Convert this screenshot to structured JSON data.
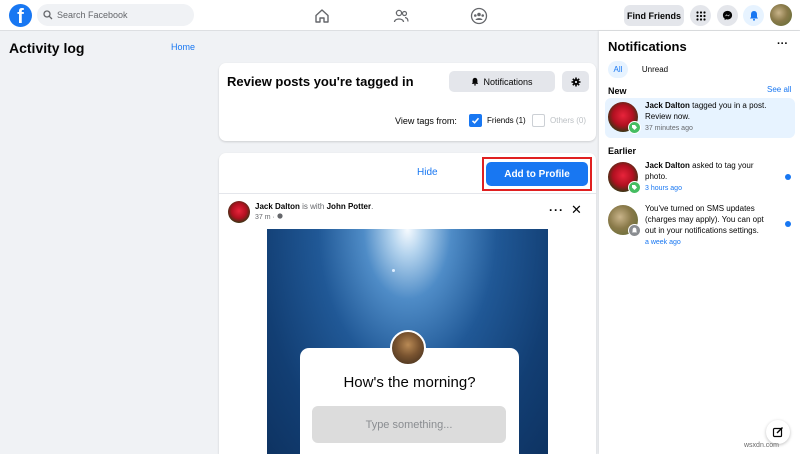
{
  "topnav": {
    "logo": "f",
    "search_placeholder": "Search Facebook",
    "find_friends": "Find Friends"
  },
  "left": {
    "title": "Activity log",
    "home_link": "Home"
  },
  "review": {
    "title": "Review posts you're tagged in",
    "notifications_button": "Notifications",
    "view_tags_label": "View tags from:",
    "friends_option": "Friends (1)",
    "friends_checked": true,
    "others_option": "Others (0)",
    "others_checked": false
  },
  "post": {
    "hide_label": "Hide",
    "add_to_profile_label": "Add to Profile",
    "author": "Jack Dalton",
    "with_text": "is with",
    "tagged": "John Potter",
    "time": "37 m",
    "prompt_question": "How's the morning?",
    "prompt_placeholder": "Type something..."
  },
  "notifications": {
    "title": "Notifications",
    "more": "···",
    "filter_all": "All",
    "filter_unread": "Unread",
    "section_new": "New",
    "see_all": "See all",
    "section_earlier": "Earlier",
    "items": [
      {
        "name": "Jack Dalton",
        "text": "tagged you in a post. Review now.",
        "time": "37 minutes ago",
        "unread": false
      },
      {
        "name": "Jack Dalton",
        "text": "asked to tag your photo.",
        "time": "3 hours ago",
        "unread": true
      },
      {
        "name": "",
        "text": "You've turned on SMS updates (charges may apply). You can opt out in your notifications settings.",
        "time": "a week ago",
        "unread": true
      }
    ]
  },
  "watermark": "wsxdn.com",
  "colors": {
    "accent": "#1877f2",
    "highlight_border": "#e02020",
    "badge_green": "#45bd62"
  },
  "icons": [
    "facebook-logo-icon",
    "search-icon",
    "home-icon",
    "friends-icon",
    "groups-icon",
    "menu-grid-icon",
    "messenger-icon",
    "bell-icon",
    "gear-icon",
    "check-icon",
    "globe-icon",
    "more-icon",
    "close-icon",
    "compose-icon"
  ]
}
